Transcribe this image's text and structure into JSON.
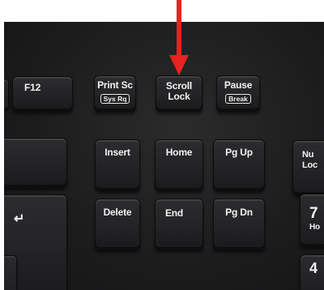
{
  "keys": {
    "f12": {
      "label": "F12"
    },
    "print_screen": {
      "label": "Print Sc",
      "sub": "Sys Rq"
    },
    "scroll_lock": {
      "line1": "Scroll",
      "line2": "Lock"
    },
    "pause": {
      "label": "Pause",
      "sub": "Break"
    },
    "insert": {
      "label": "Insert"
    },
    "home": {
      "label": "Home"
    },
    "page_up": {
      "label": "Pg Up"
    },
    "num_lock": {
      "line1": "Nu",
      "line2": "Loc"
    },
    "enter": {
      "label": "↵"
    },
    "delete": {
      "label": "Delete"
    },
    "end": {
      "label": "End"
    },
    "page_down": {
      "label": "Pg Dn"
    },
    "numpad_7": {
      "label": "7",
      "sub": "Ho"
    },
    "numpad_4": {
      "label": "4"
    }
  },
  "arrow": {
    "color": "#e8231f",
    "points_to": "scroll-lock-key"
  }
}
